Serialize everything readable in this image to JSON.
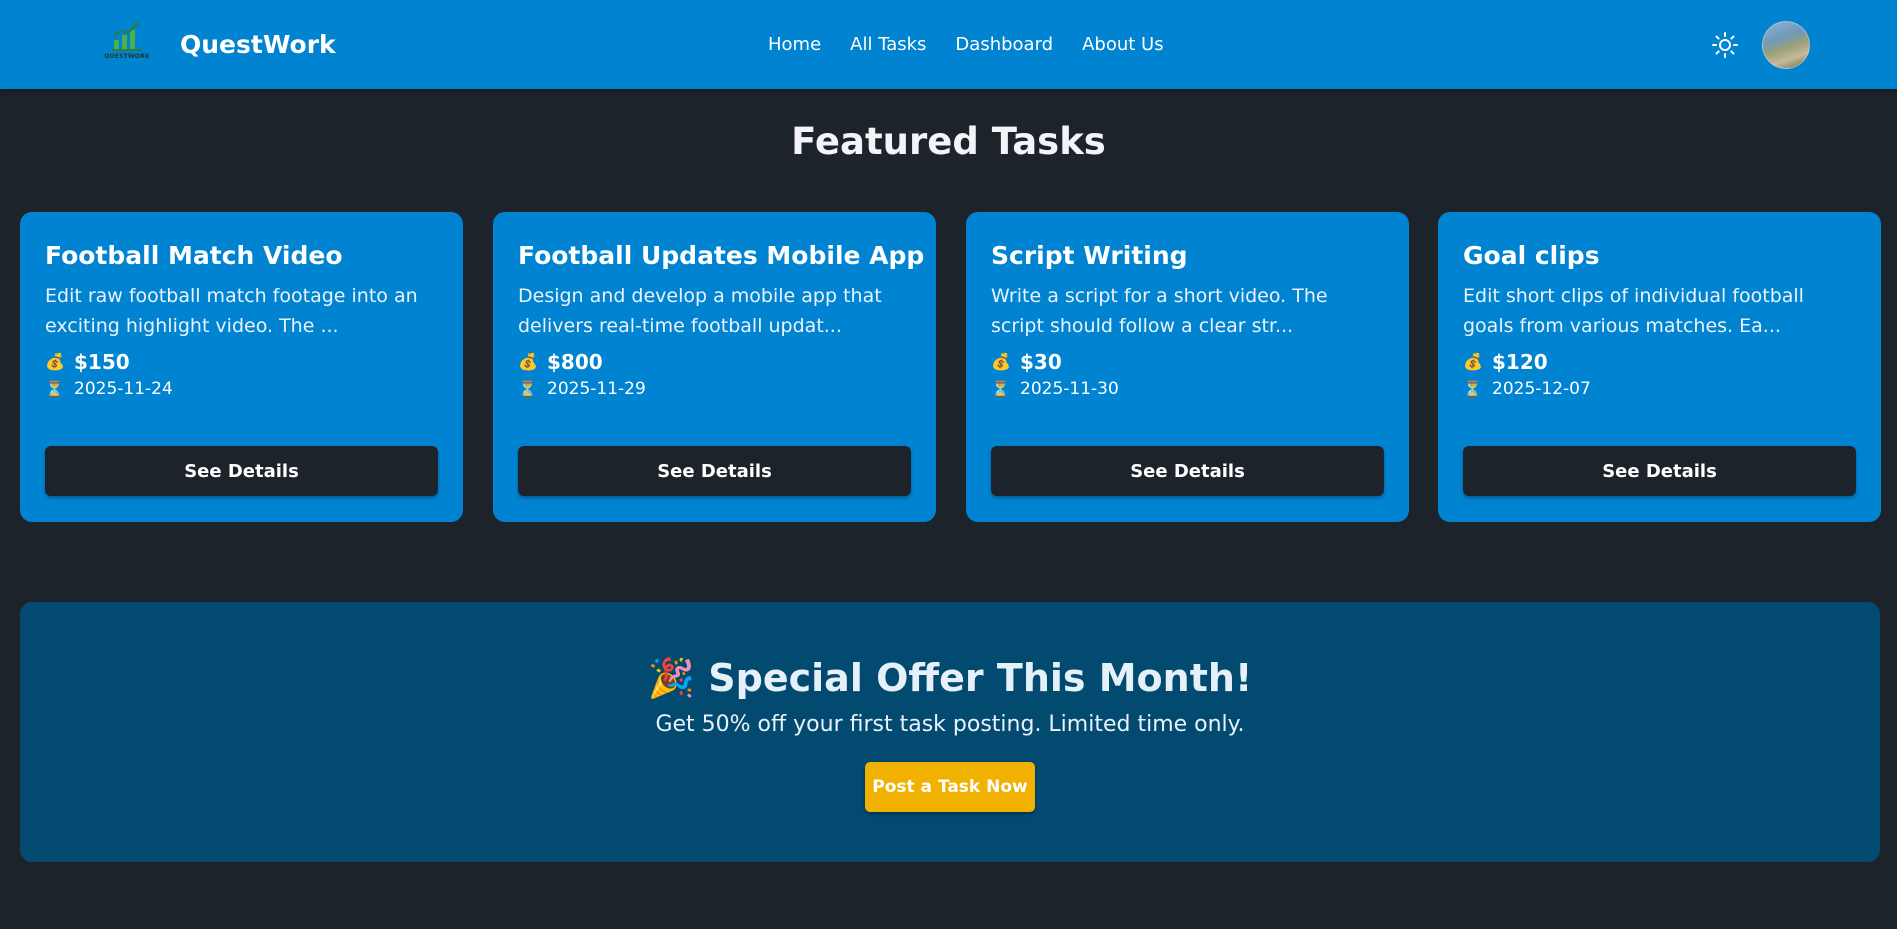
{
  "navbar": {
    "logo_text": "QUESTWORK",
    "brand": "QuestWork",
    "links": [
      "Home",
      "All Tasks",
      "Dashboard",
      "About Us"
    ],
    "theme_icon": "sun-icon",
    "avatar_icon": "user-avatar"
  },
  "featured": {
    "title": "Featured Tasks",
    "price_icon": "💰",
    "deadline_icon": "⏳",
    "button_label": "See Details",
    "cards": [
      {
        "title": "Football Match Video",
        "description": "Edit raw football match footage into an exciting highlight video. The ...",
        "price": "$150",
        "deadline": "2025-11-24"
      },
      {
        "title": "Football Updates Mobile App",
        "description": "Design and develop a mobile app that delivers real-time football updat...",
        "price": "$800",
        "deadline": "2025-11-29"
      },
      {
        "title": "Script Writing",
        "description": "Write a script for a short video. The script should follow a clear str...",
        "price": "$30",
        "deadline": "2025-11-30"
      },
      {
        "title": "Goal clips",
        "description": "Edit short clips of individual football goals from various matches. Ea...",
        "price": "$120",
        "deadline": "2025-12-07"
      }
    ]
  },
  "offer": {
    "emoji": "🎉",
    "title": "Special Offer This Month!",
    "subtitle": "Get 50% off your first task posting. Limited time only.",
    "button_label": "Post a Task Now"
  },
  "colors": {
    "navbar": "#0083d1",
    "background": "#1d232a",
    "card": "#0083d1",
    "button_dark": "#1d232a",
    "offer_bg": "#024a70",
    "offer_button": "#f0b100"
  }
}
